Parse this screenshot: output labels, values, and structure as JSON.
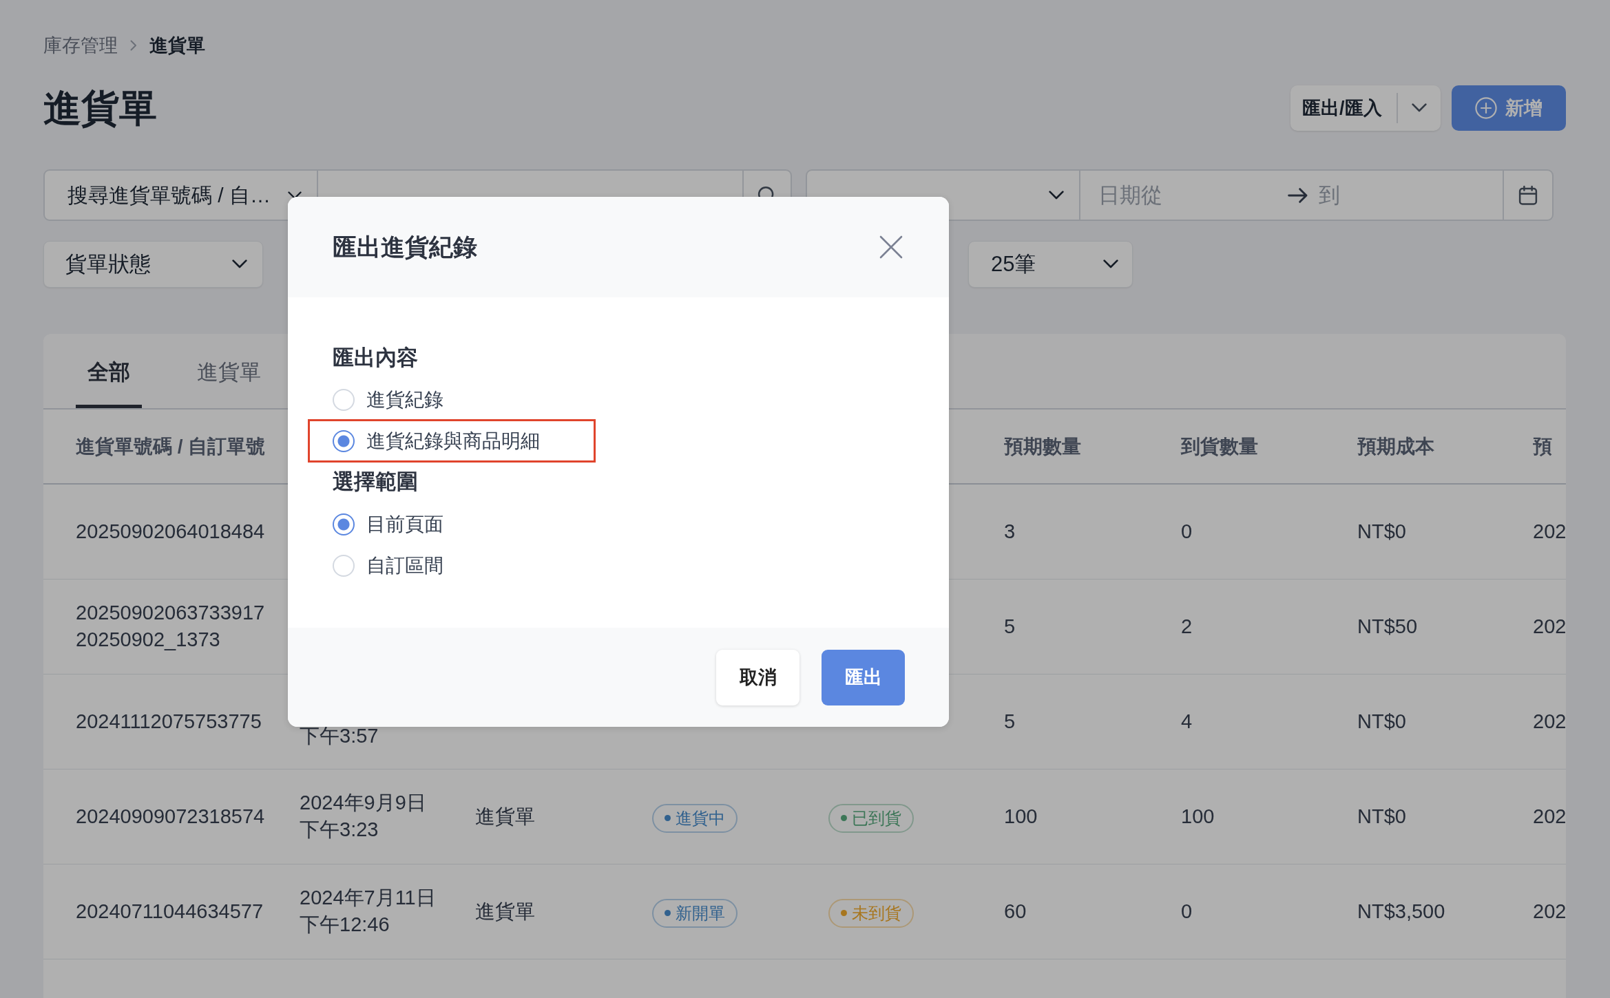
{
  "breadcrumb": [
    {
      "label": "庫存管理",
      "current": false
    },
    {
      "label": "進貨單",
      "current": true
    }
  ],
  "page_title": "進貨單",
  "actions": {
    "export_import": "匯出/匯入",
    "add": "新增"
  },
  "filters": {
    "search_by": "搜尋進貨單號碼 / 自…",
    "date_from": {
      "placeholder": "日期從"
    },
    "date_to": {
      "placeholder": "到"
    },
    "order_status": "貨單狀態",
    "page_size": "25筆"
  },
  "tabs": [
    {
      "label": "全部",
      "selected": true
    },
    {
      "label": "進貨單",
      "selected": false
    }
  ],
  "table": {
    "columns": [
      "進貨單號碼 / 自訂單號",
      null,
      null,
      null,
      null,
      "預期數量",
      "到貨數量",
      "預期成本",
      "預"
    ],
    "rows": [
      {
        "order_no": "20250902064018484",
        "expected_qty": "3",
        "received_qty": "0",
        "expected_cost": "NT$0",
        "column_9": "202"
      },
      {
        "order_no": "20250902063733917",
        "custom_no": "20250902_1373",
        "expected_qty": "5",
        "received_qty": "2",
        "expected_cost": "NT$50",
        "column_9": "202"
      },
      {
        "order_no": "20241112075753775",
        "time": "下午3:57",
        "expected_qty": "5",
        "received_qty": "4",
        "expected_cost": "NT$0",
        "column_9": "202"
      },
      {
        "order_no": "20240909072318574",
        "date": "2024年9月9日",
        "time": "下午3:23",
        "type": "進貨單",
        "status": {
          "label": "進貨中",
          "color": "#31618e"
        },
        "arrival": {
          "label": "已到貨",
          "color": "#3c7657"
        },
        "expected_qty": "100",
        "received_qty": "100",
        "expected_cost": "NT$0",
        "column_9": "202"
      },
      {
        "order_no": "20240711044634577",
        "date": "2024年7月11日",
        "time": "下午12:46",
        "type": "進貨單",
        "status": {
          "label": "新開單",
          "color": "#31618e"
        },
        "arrival": {
          "label": "未到貨",
          "color": "#a7761f"
        },
        "expected_qty": "60",
        "received_qty": "0",
        "expected_cost": "NT$3,500",
        "column_9": "202"
      }
    ]
  },
  "modal": {
    "title": "匯出進貨紀錄",
    "sections": [
      {
        "heading": "匯出內容",
        "options": [
          {
            "label": "進貨紀錄",
            "selected": false,
            "highlighted": false
          },
          {
            "label": "進貨紀錄與商品明細",
            "selected": true,
            "highlighted": true
          }
        ]
      },
      {
        "heading": "選擇範圍",
        "options": [
          {
            "label": "目前頁面",
            "selected": true,
            "highlighted": false
          },
          {
            "label": "自訂區間",
            "selected": false,
            "highlighted": false
          }
        ]
      }
    ],
    "buttons": [
      {
        "label": "取消",
        "kind": "secondary"
      },
      {
        "label": "匯出",
        "kind": "primary"
      }
    ]
  }
}
